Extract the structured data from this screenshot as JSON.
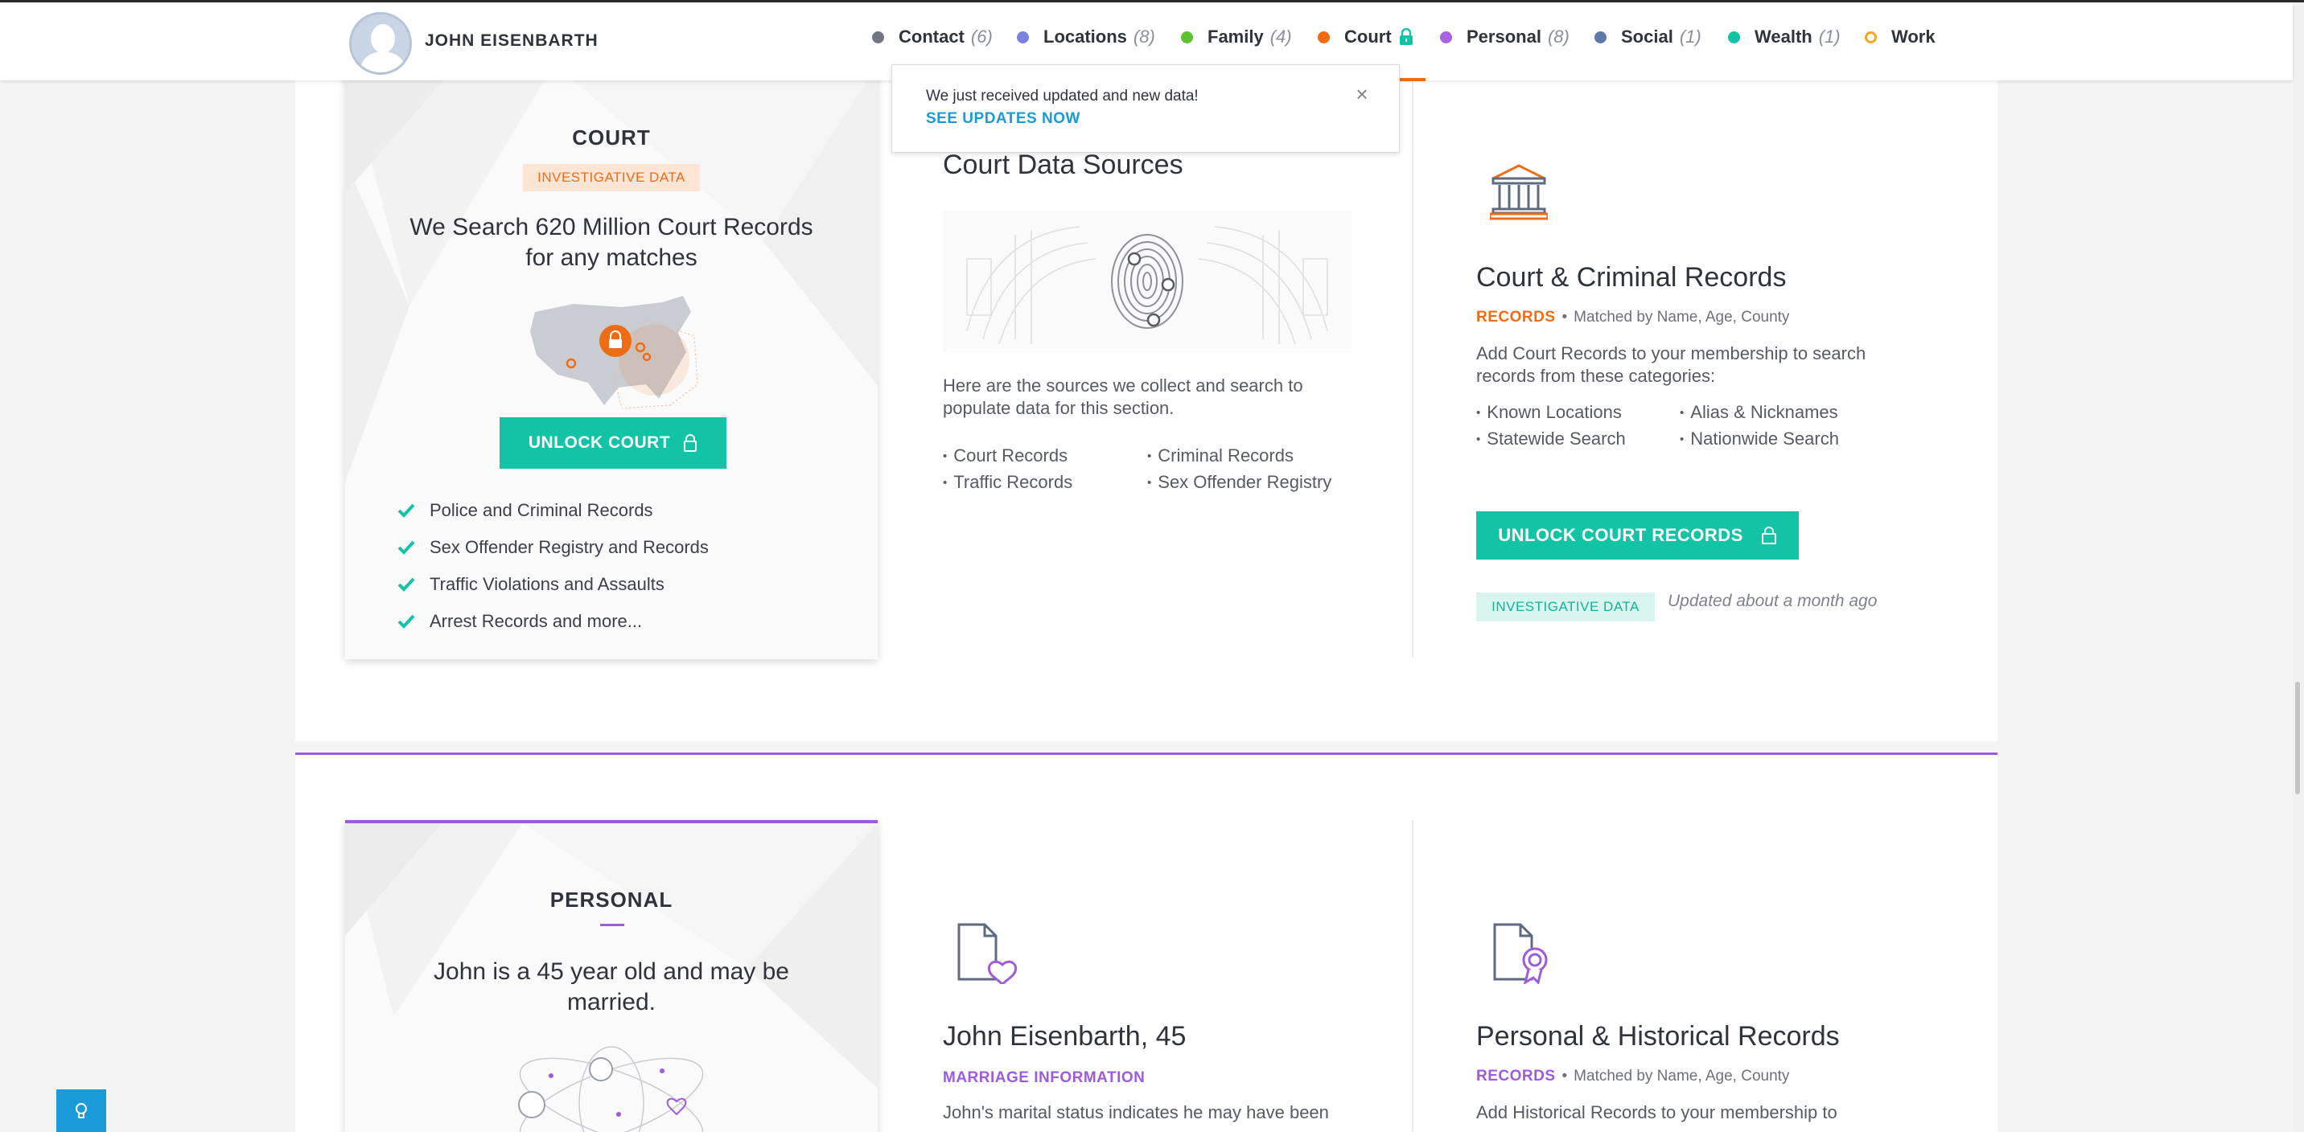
{
  "header": {
    "person_name": "JOHN EISENBARTH",
    "nav": [
      {
        "label": "Contact",
        "count": "(6)",
        "color": "#6f7784",
        "locked": false
      },
      {
        "label": "Locations",
        "count": "(8)",
        "color": "#7b83e0",
        "locked": false
      },
      {
        "label": "Family",
        "count": "(4)",
        "color": "#5cc230",
        "locked": false
      },
      {
        "label": "Court",
        "count": "",
        "color": "#f06c14",
        "locked": true,
        "active": true
      },
      {
        "label": "Personal",
        "count": "(8)",
        "color": "#a864e0",
        "locked": false
      },
      {
        "label": "Social",
        "count": "(1)",
        "color": "#5d79ab",
        "locked": false
      },
      {
        "label": "Wealth",
        "count": "(1)",
        "color": "#12c3a6",
        "locked": false
      },
      {
        "label": "Work",
        "count": "",
        "color": "#f5a623",
        "locked": false,
        "hollow": true
      }
    ]
  },
  "toast": {
    "message": "We just received updated and new data!",
    "link": "SEE UPDATES NOW",
    "close": "×"
  },
  "court": {
    "card": {
      "title": "COURT",
      "badge": "INVESTIGATIVE DATA",
      "headline_line1": "We Search 620 Million Court Records",
      "headline_line2": "for any matches",
      "unlock_button": "UNLOCK COURT",
      "features": [
        "Police and Criminal Records",
        "Sex Offender Registry and Records",
        "Traffic Violations and Assaults",
        "Arrest Records and more..."
      ]
    },
    "sources": {
      "title": "Court Data Sources",
      "description": "Here are the sources we collect and search to populate data for this section.",
      "left_list": [
        "Court Records",
        "Traffic Records"
      ],
      "right_list": [
        "Criminal Records",
        "Sex Offender Registry"
      ]
    },
    "records": {
      "title": "Court & Criminal Records",
      "tag": "RECORDS",
      "matched": "Matched by Name, Age, County",
      "description": "Add Court Records to your membership to search records from these categories:",
      "left_list": [
        "Known Locations",
        "Statewide Search"
      ],
      "right_list": [
        "Alias & Nicknames",
        "Nationwide Search"
      ],
      "unlock_button": "UNLOCK COURT RECORDS",
      "badge": "INVESTIGATIVE DATA",
      "updated": "Updated about a month ago"
    }
  },
  "personal": {
    "card": {
      "title": "PERSONAL",
      "headline_line1": "John is a 45 year old and may be",
      "headline_line2": "married."
    },
    "marriage": {
      "title": "John Eisenbarth, 45",
      "tag": "MARRIAGE INFORMATION",
      "description": "John's marital status indicates he may have been"
    },
    "historical": {
      "title": "Personal & Historical Records",
      "tag": "RECORDS",
      "matched": "Matched by Name, Age, County",
      "description": "Add Historical Records to your membership to"
    }
  },
  "colors": {
    "accent_teal": "#12c3a6",
    "court_orange": "#f06c14",
    "personal_purple": "#9e5cdb",
    "link_blue": "#1a9bd8"
  }
}
